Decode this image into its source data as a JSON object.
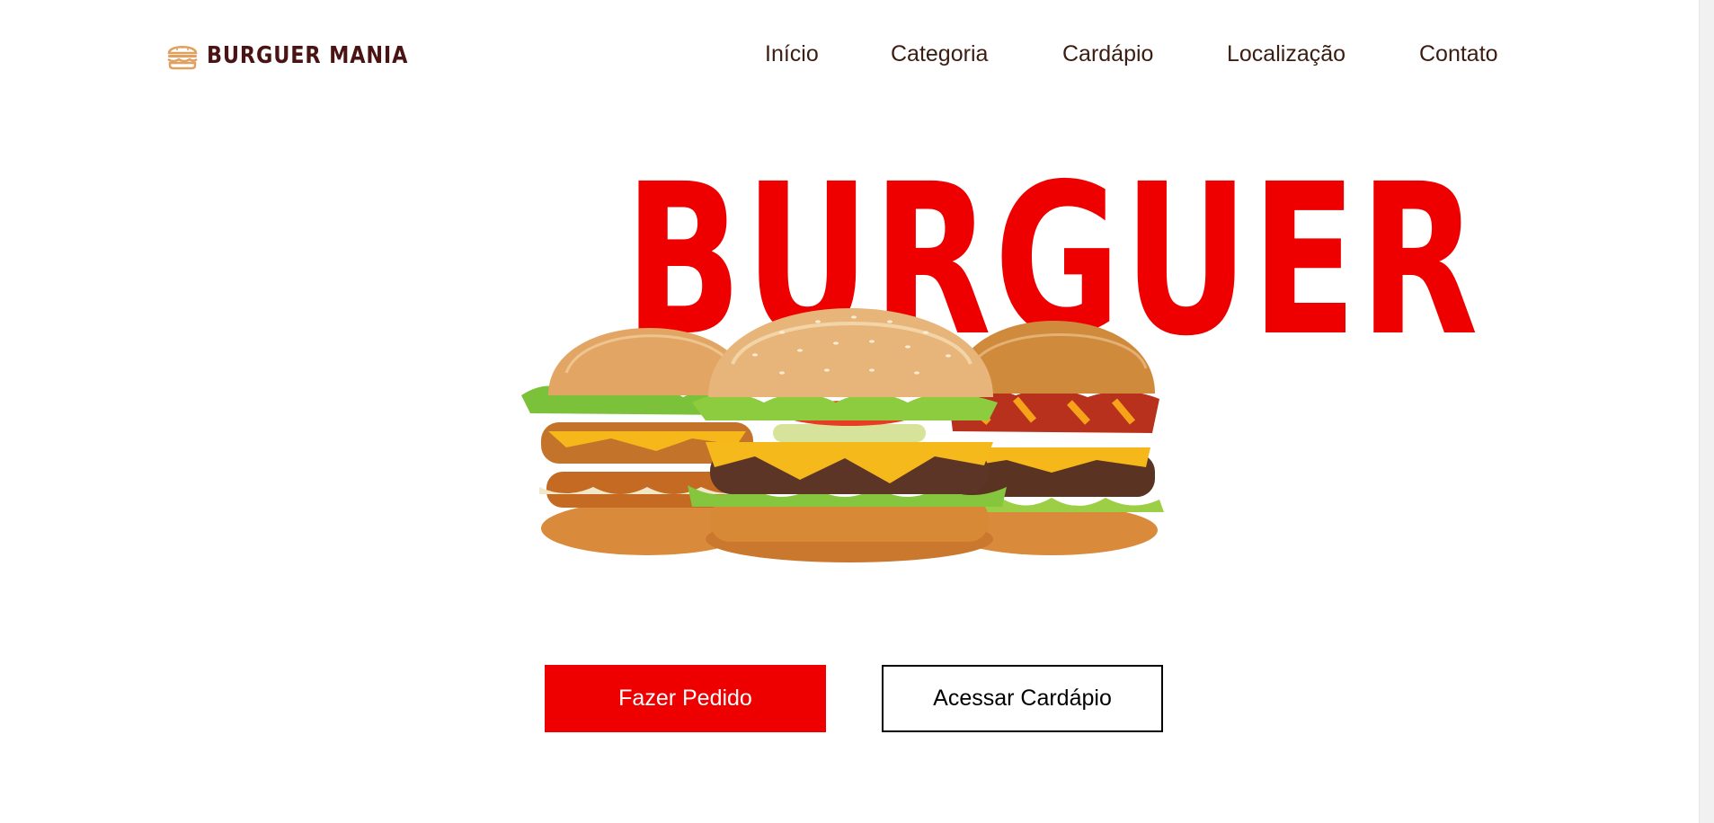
{
  "brand": {
    "name": "BURGUER MANIA",
    "icon": "burger-icon",
    "color": "#4a1414",
    "icon_color": "#e0a060"
  },
  "nav": {
    "items": [
      {
        "label": "Início"
      },
      {
        "label": "Categoria"
      },
      {
        "label": "Cardápio"
      },
      {
        "label": "Localização"
      },
      {
        "label": "Contato"
      }
    ],
    "color": "#3b1d12"
  },
  "hero": {
    "title": "BURGUER",
    "title_color": "#ee0000",
    "image": "three-burgers-image"
  },
  "buttons": {
    "order_label": "Fazer Pedido",
    "menu_label": "Acessar Cardápio",
    "primary_color": "#ee0000"
  }
}
